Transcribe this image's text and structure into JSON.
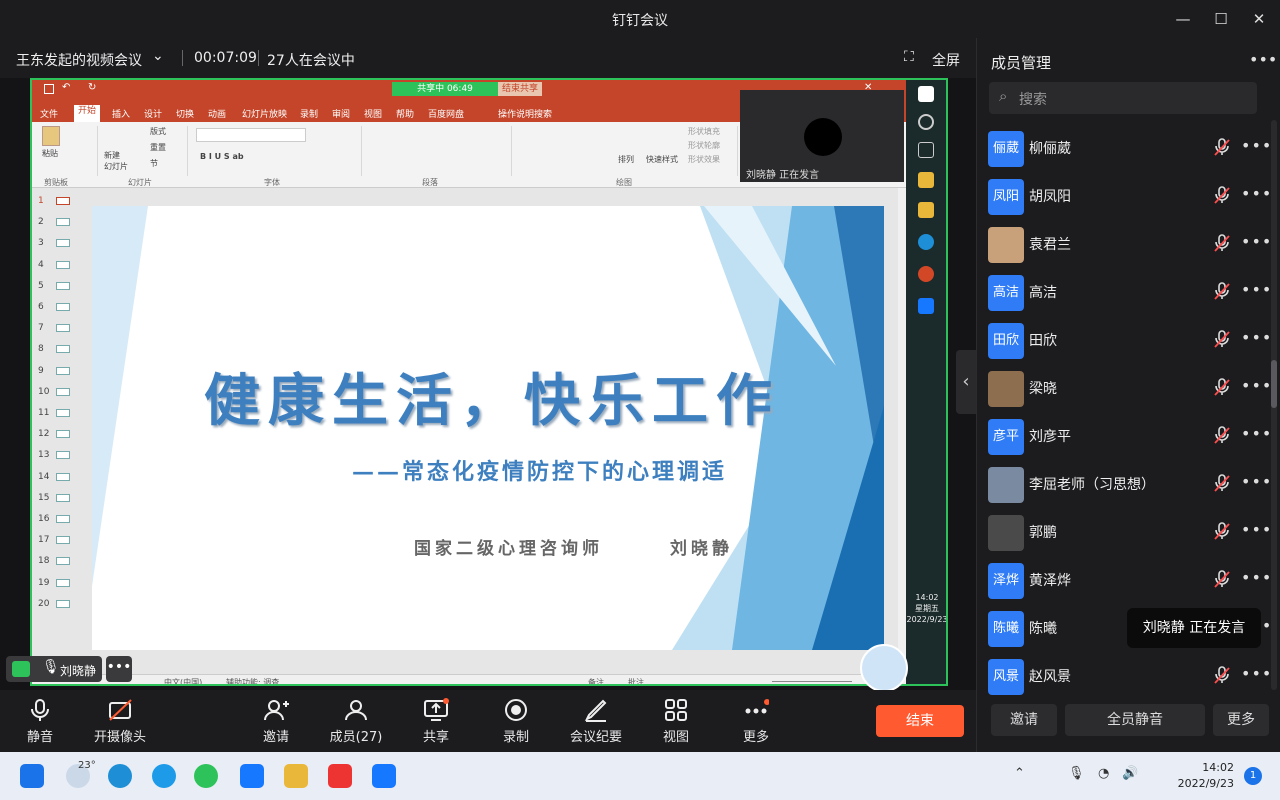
{
  "window": {
    "title": "钉钉会议"
  },
  "meeting": {
    "name": "王东发起的视频会议",
    "duration": "00:07:09",
    "participants_text": "27人在会议中",
    "fullscreen_label": "全屏"
  },
  "ppt": {
    "share_status": "共享中 06:49",
    "end_share": "结束共享",
    "menu": [
      "文件",
      "开始",
      "插入",
      "设计",
      "切换",
      "动画",
      "幻灯片放映",
      "录制",
      "审阅",
      "视图",
      "帮助",
      "百度网盘",
      "操作说明搜索"
    ],
    "ribbon_groups": [
      "剪贴板",
      "幻灯片",
      "字体",
      "段落",
      "绘图"
    ],
    "ribbon_items": {
      "paste": "粘贴",
      "new_slide": "新建\n幻灯片",
      "layout": "版式",
      "reset": "重置",
      "section": "节",
      "arrange": "排列",
      "quick_style": "快速样式",
      "fill": "形状填充",
      "outline": "形状轮廓",
      "effect": "形状效果"
    },
    "slide_numbers": [
      "1",
      "2",
      "3",
      "4",
      "5",
      "6",
      "7",
      "8",
      "9",
      "10",
      "11",
      "12",
      "13",
      "14",
      "15",
      "16",
      "17",
      "18",
      "19",
      "20"
    ],
    "status_lang": "中文(中国)",
    "status_access": "辅助功能: 调查",
    "status_notes": "备注",
    "status_comments": "批注",
    "self_speaking": "刘晓静 正在发言",
    "taskbar_time": "14:02",
    "taskbar_day": "星期五",
    "taskbar_date": "2022/9/23"
  },
  "slide": {
    "title": "健康生活，快乐工作",
    "subtitle": "——常态化疫情防控下的心理调适",
    "presenter_role": "国家二级心理咨询师",
    "presenter_name": "刘晓静"
  },
  "speaker_badge": "刘晓静",
  "toolbar": [
    {
      "label": "静音",
      "icon": "mic-icon"
    },
    {
      "label": "开摄像头",
      "icon": "camera-off-icon"
    },
    {
      "label": "邀请",
      "icon": "invite-icon"
    },
    {
      "label": "成员(27)",
      "icon": "members-icon"
    },
    {
      "label": "共享",
      "icon": "share-screen-icon"
    },
    {
      "label": "录制",
      "icon": "record-icon"
    },
    {
      "label": "会议纪要",
      "icon": "minutes-icon"
    },
    {
      "label": "视图",
      "icon": "grid-view-icon"
    },
    {
      "label": "更多",
      "icon": "more-icon"
    }
  ],
  "end_button": "结束",
  "panel": {
    "title": "成员管理",
    "search_placeholder": "搜索",
    "members": [
      {
        "avatar": "俪葳",
        "name": "柳俪葳"
      },
      {
        "avatar": "凤阳",
        "name": "胡凤阳"
      },
      {
        "avatar": "",
        "name": "袁君兰"
      },
      {
        "avatar": "高洁",
        "name": "高洁"
      },
      {
        "avatar": "田欣",
        "name": "田欣"
      },
      {
        "avatar": "",
        "name": "梁晓"
      },
      {
        "avatar": "彦平",
        "name": "刘彦平"
      },
      {
        "avatar": "",
        "name": "李屈老师（习思想）"
      },
      {
        "avatar": "",
        "name": "郭鹏"
      },
      {
        "avatar": "泽烨",
        "name": "黄泽烨"
      },
      {
        "avatar": "陈曦",
        "name": "陈曦"
      },
      {
        "avatar": "风景",
        "name": "赵风景"
      }
    ],
    "tooltip": "刘晓静  正在发言",
    "buttons": {
      "invite": "邀请",
      "mute_all": "全员静音",
      "more": "更多"
    }
  },
  "os_taskbar": {
    "temp": "23°",
    "time": "14:02",
    "date": "2022/9/23",
    "notif": "1"
  }
}
